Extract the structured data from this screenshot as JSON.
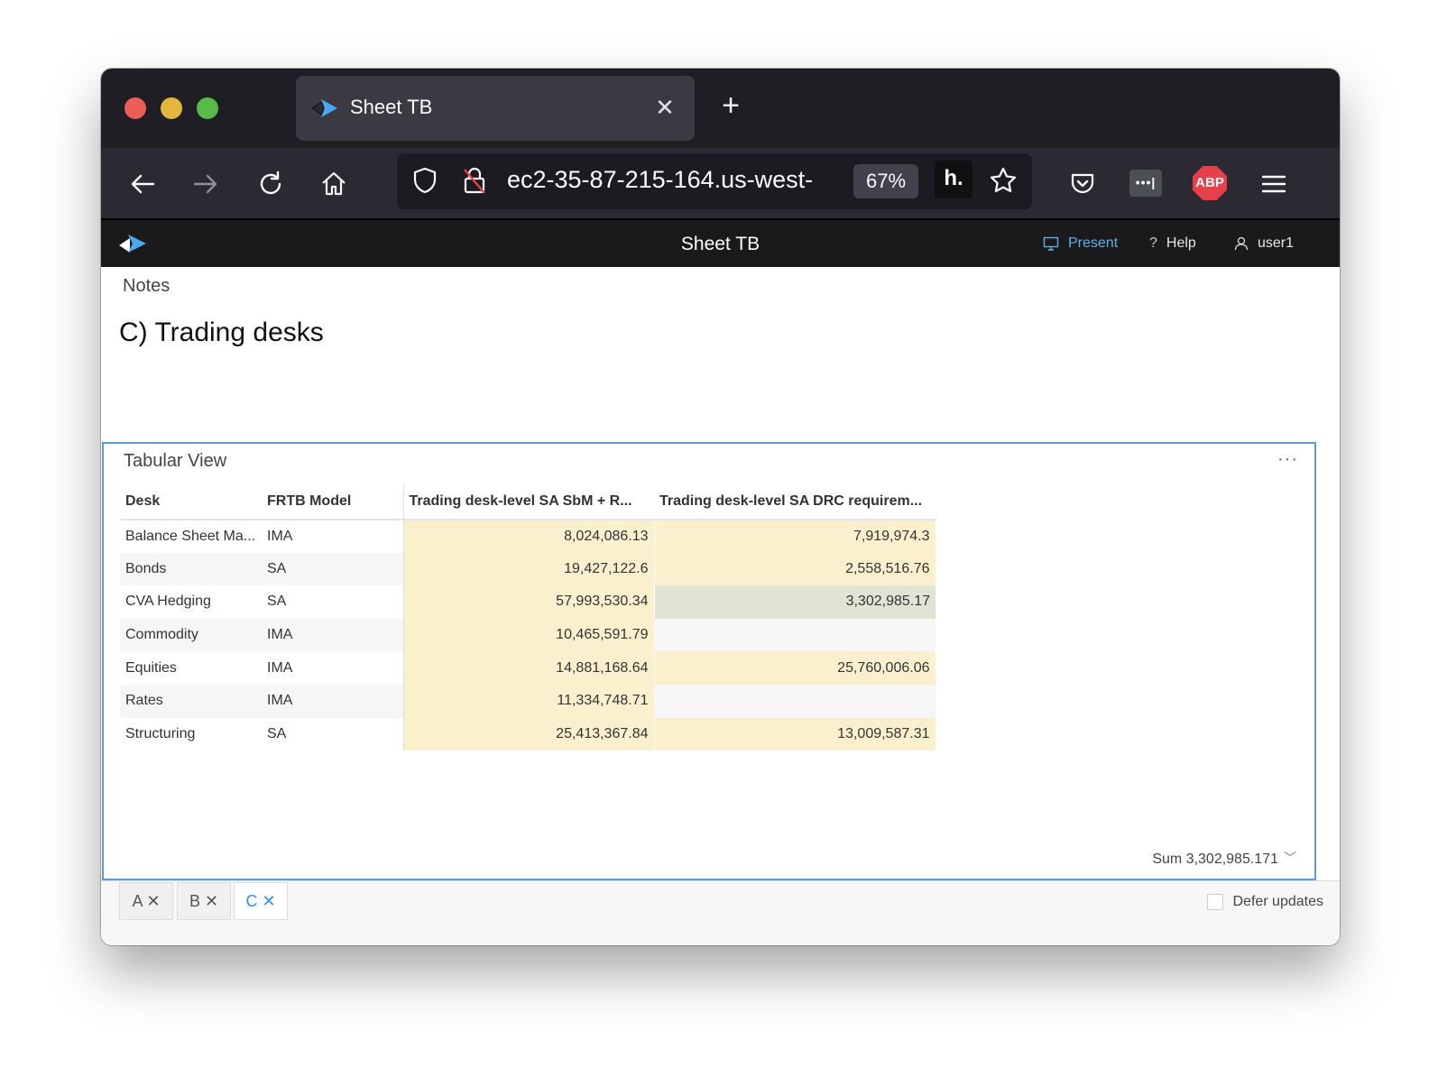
{
  "browser": {
    "tab_title": "Sheet TB",
    "tab_close": "✕",
    "new_tab": "+",
    "url": "ec2-35-87-215-164.us-west-",
    "zoom": "67%",
    "hypothesis_label": "h.",
    "abp_label": "ABP",
    "lastpass_label": "•••|"
  },
  "app": {
    "title": "Sheet TB",
    "present": "Present",
    "help": "Help",
    "user": "user1",
    "accent_color": "#5fb0f3"
  },
  "notes": {
    "label": "Notes",
    "heading": "C) Trading desks"
  },
  "panel": {
    "title": "Tabular View",
    "more": "···",
    "columns": [
      "Desk",
      "FRTB Model",
      "Trading desk-level SA SbM + R...",
      "Trading desk-level SA DRC requirem..."
    ],
    "rows": [
      {
        "desk": "Balance Sheet Ma...",
        "model": "IMA",
        "sbm": "8,024,086.13",
        "drc": "7,919,974.3"
      },
      {
        "desk": "Bonds",
        "model": "SA",
        "sbm": "19,427,122.6",
        "drc": "2,558,516.76"
      },
      {
        "desk": "CVA Hedging",
        "model": "SA",
        "sbm": "57,993,530.34",
        "drc": "3,302,985.17"
      },
      {
        "desk": "Commodity",
        "model": "IMA",
        "sbm": "10,465,591.79",
        "drc": ""
      },
      {
        "desk": "Equities",
        "model": "IMA",
        "sbm": "14,881,168.64",
        "drc": "25,760,006.06"
      },
      {
        "desk": "Rates",
        "model": "IMA",
        "sbm": "11,334,748.71",
        "drc": ""
      },
      {
        "desk": "Structuring",
        "model": "SA",
        "sbm": "25,413,367.84",
        "drc": "13,009,587.31"
      }
    ],
    "sum": "Sum 3,302,985.171"
  },
  "bottom": {
    "tabs": [
      {
        "label": "A",
        "close": "✕"
      },
      {
        "label": "B",
        "close": "✕"
      },
      {
        "label": "C",
        "close": "✕"
      }
    ],
    "defer_label": "Defer updates"
  }
}
